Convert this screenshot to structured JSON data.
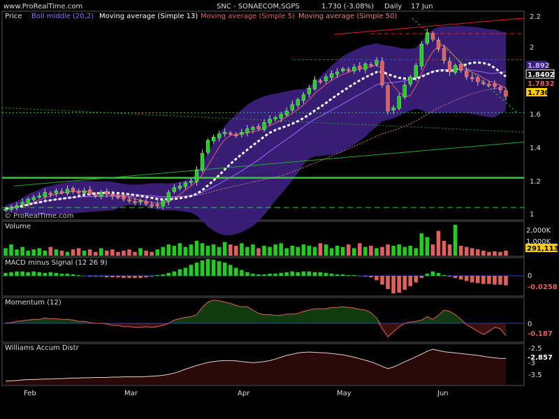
{
  "header": {
    "site": "www.ProRealTime.com",
    "title": "SNC - SONAECOM,SGPS",
    "quote": "1.730 (-3.08%)",
    "period": "Daily",
    "date": "17 Jun"
  },
  "colors": {
    "up": "#22cc22",
    "down": "#e06060",
    "band": "#3a1f7a",
    "sma13": "#ffffff",
    "sma5": "#e06060",
    "sma50": "#e08080",
    "grid": "#33cc33",
    "zero": "#2244cc"
  },
  "x_months": [
    "Feb",
    "Mar",
    "Apr",
    "May",
    "Jun"
  ],
  "chart_data": [
    {
      "name": "price",
      "type": "candlestick",
      "legend": [
        "Price",
        "Boll middle (20,2)",
        "Moving average (Simple 13)",
        "Moving average (Simple 5)",
        "Moving average (Simple 50)"
      ],
      "copyright": "© ProRealTime.com",
      "y_ticks": [
        "2.2",
        "2",
        "1.8",
        "1.6",
        "1.4",
        "1.2",
        "1"
      ],
      "ylim": [
        0.98,
        2.24
      ],
      "close": [
        1.04,
        1.05,
        1.06,
        1.08,
        1.1,
        1.11,
        1.12,
        1.14,
        1.13,
        1.15,
        1.14,
        1.16,
        1.15,
        1.14,
        1.15,
        1.13,
        1.12,
        1.14,
        1.13,
        1.12,
        1.11,
        1.1,
        1.09,
        1.08,
        1.09,
        1.07,
        1.06,
        1.06,
        1.09,
        1.14,
        1.17,
        1.18,
        1.2,
        1.21,
        1.28,
        1.38,
        1.46,
        1.48,
        1.5,
        1.51,
        1.5,
        1.49,
        1.51,
        1.53,
        1.54,
        1.53,
        1.57,
        1.59,
        1.6,
        1.62,
        1.64,
        1.68,
        1.71,
        1.74,
        1.78,
        1.83,
        1.82,
        1.85,
        1.87,
        1.88,
        1.9,
        1.89,
        1.91,
        1.9,
        1.93,
        1.92,
        1.95,
        1.8,
        1.64,
        1.66,
        1.73,
        1.8,
        1.85,
        1.92,
        2.05,
        2.12,
        2.08,
        2.02,
        1.95,
        1.88,
        1.92,
        1.89,
        1.85,
        1.84,
        1.82,
        1.81,
        1.8,
        1.79,
        1.77,
        1.73
      ],
      "boll_middle_last": "1.8402",
      "sma_last": "1.7832",
      "boll_upper_last": "1.892",
      "last": "1.730"
    },
    {
      "name": "volume",
      "type": "bar",
      "title": "Volume",
      "y_ticks": [
        "2,000K",
        "1,000K"
      ],
      "values": [
        600,
        900,
        500,
        700,
        400,
        500,
        600,
        400,
        700,
        500,
        400,
        300,
        500,
        600,
        400,
        500,
        300,
        600,
        400,
        500,
        300,
        400,
        500,
        300,
        600,
        400,
        300,
        500,
        700,
        900,
        800,
        1000,
        700,
        900,
        1200,
        1000,
        800,
        900,
        700,
        1100,
        900,
        800,
        1000,
        700,
        900,
        600,
        800,
        700,
        900,
        1000,
        600,
        800,
        700,
        900,
        800,
        700,
        1000,
        900,
        600,
        800,
        700,
        900,
        600,
        1000,
        700,
        800,
        600,
        700,
        900,
        800,
        900,
        700,
        800,
        600,
        1800,
        1500,
        900,
        2000,
        1200,
        900,
        2500,
        800,
        700,
        600,
        500,
        400,
        300,
        350,
        300,
        400
      ],
      "last": "291,113"
    },
    {
      "name": "macd",
      "type": "histogram",
      "title": "MACD minus Signal (12 26 9)",
      "y_ticks": [
        "0"
      ],
      "values": [
        0.4,
        0.5,
        0.6,
        0.6,
        0.5,
        0.6,
        0.5,
        0.4,
        0.5,
        0.4,
        0.3,
        0.3,
        0.2,
        0.1,
        0.0,
        -0.1,
        -0.1,
        -0.1,
        -0.2,
        -0.2,
        -0.2,
        -0.3,
        -0.3,
        -0.3,
        -0.3,
        -0.2,
        -0.1,
        0.1,
        0.2,
        0.4,
        0.6,
        0.9,
        1.1,
        1.5,
        1.8,
        2.1,
        2.3,
        2.2,
        2.0,
        1.8,
        1.5,
        1.1,
        0.8,
        0.5,
        0.3,
        0.2,
        0.2,
        0.3,
        0.3,
        0.4,
        0.5,
        0.6,
        0.5,
        0.6,
        0.6,
        0.5,
        0.5,
        0.4,
        0.3,
        0.2,
        0.2,
        0.1,
        0.1,
        0.0,
        -0.1,
        -0.2,
        -0.6,
        -1.2,
        -1.8,
        -2.4,
        -2.3,
        -1.9,
        -1.4,
        -0.9,
        -0.3,
        0.3,
        0.6,
        0.4,
        0.1,
        -0.1,
        -0.3,
        -0.5,
        -0.7,
        -0.9,
        -1.0,
        -1.1,
        -1.1,
        -1.2,
        -1.2,
        -1.3
      ],
      "last": "-0.0258"
    },
    {
      "name": "momentum",
      "type": "area",
      "title": "Momentum (12)",
      "y_ticks": [
        "0"
      ],
      "values": [
        0.005,
        0.01,
        0.03,
        0.04,
        0.05,
        0.06,
        0.06,
        0.08,
        0.07,
        0.07,
        0.06,
        0.06,
        0.05,
        0.03,
        0.03,
        0.01,
        0.0,
        0.0,
        -0.01,
        -0.03,
        -0.03,
        -0.05,
        -0.05,
        -0.06,
        -0.06,
        -0.05,
        -0.06,
        -0.05,
        -0.03,
        0.0,
        0.05,
        0.07,
        0.09,
        0.1,
        0.13,
        0.24,
        0.32,
        0.35,
        0.34,
        0.32,
        0.3,
        0.27,
        0.25,
        0.25,
        0.2,
        0.15,
        0.13,
        0.13,
        0.12,
        0.12,
        0.14,
        0.14,
        0.15,
        0.18,
        0.2,
        0.22,
        0.22,
        0.22,
        0.24,
        0.24,
        0.25,
        0.24,
        0.23,
        0.21,
        0.2,
        0.16,
        0.08,
        -0.08,
        -0.2,
        -0.13,
        -0.05,
        0.0,
        0.02,
        0.03,
        0.05,
        0.1,
        0.06,
        0.12,
        0.2,
        0.18,
        0.13,
        0.06,
        -0.02,
        -0.07,
        -0.12,
        -0.17,
        -0.12,
        -0.06,
        -0.08,
        -0.187
      ],
      "last": "-0.187"
    },
    {
      "name": "williams",
      "type": "area",
      "title": "Williams Accum Distr",
      "y_ticks": [
        "-2.5",
        "-3",
        "-3.5"
      ],
      "ylim": [
        -3.72,
        -2.42
      ],
      "values": [
        -3.6,
        -3.59,
        -3.58,
        -3.56,
        -3.55,
        -3.55,
        -3.54,
        -3.53,
        -3.53,
        -3.52,
        -3.52,
        -3.51,
        -3.5,
        -3.5,
        -3.49,
        -3.49,
        -3.48,
        -3.48,
        -3.48,
        -3.47,
        -3.47,
        -3.46,
        -3.46,
        -3.46,
        -3.46,
        -3.45,
        -3.44,
        -3.43,
        -3.41,
        -3.38,
        -3.34,
        -3.28,
        -3.21,
        -3.15,
        -3.09,
        -3.04,
        -2.99,
        -2.96,
        -2.94,
        -2.93,
        -2.93,
        -2.94,
        -2.96,
        -2.98,
        -3.0,
        -2.98,
        -2.96,
        -2.93,
        -2.88,
        -2.82,
        -2.76,
        -2.72,
        -2.68,
        -2.66,
        -2.65,
        -2.66,
        -2.67,
        -2.68,
        -2.7,
        -2.72,
        -2.74,
        -2.78,
        -2.82,
        -2.87,
        -2.92,
        -2.97,
        -3.04,
        -3.12,
        -3.19,
        -3.14,
        -3.06,
        -2.97,
        -2.89,
        -2.8,
        -2.72,
        -2.62,
        -2.56,
        -2.6,
        -2.64,
        -2.66,
        -2.68,
        -2.7,
        -2.72,
        -2.74,
        -2.76,
        -2.79,
        -2.82,
        -2.84,
        -2.86,
        -2.857
      ],
      "last": "-2.857"
    }
  ]
}
